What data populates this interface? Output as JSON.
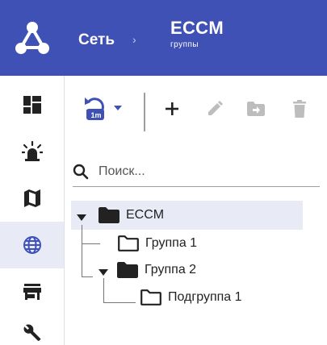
{
  "header": {
    "logo_icon": "network-logo-icon",
    "breadcrumb_root": "Сеть",
    "breadcrumb_separator": "›",
    "current_title": "ECCM",
    "current_subtitle": "группы",
    "background": "#3f51b5"
  },
  "sidebar": {
    "items": [
      {
        "name": "dashboard",
        "icon": "dashboard-icon",
        "active": false
      },
      {
        "name": "alarms",
        "icon": "alarm-light-icon",
        "active": false
      },
      {
        "name": "map",
        "icon": "map-icon",
        "active": false
      },
      {
        "name": "network",
        "icon": "globe-icon",
        "active": true
      },
      {
        "name": "store",
        "icon": "store-icon",
        "active": false
      },
      {
        "name": "settings",
        "icon": "wrench-icon",
        "active": false
      }
    ]
  },
  "toolbar": {
    "refresh_badge": "1m",
    "refresh_icon": "refresh-interval-icon",
    "add_icon": "plus-icon",
    "edit_icon": "pencil-icon",
    "move_icon": "folder-move-icon",
    "delete_icon": "trash-icon",
    "accent": "#3f51b5"
  },
  "search": {
    "placeholder": "Поиск...",
    "value": ""
  },
  "tree": {
    "nodes": [
      {
        "label": "ECCM",
        "expanded": true,
        "selected": true,
        "level": 0,
        "icon": "folder-filled-icon"
      },
      {
        "label": "Группа 1",
        "expanded": false,
        "selected": false,
        "level": 1,
        "icon": "folder-outline-icon"
      },
      {
        "label": "Группа 2",
        "expanded": true,
        "selected": false,
        "level": 1,
        "icon": "folder-filled-icon"
      },
      {
        "label": "Подгруппа 1",
        "expanded": false,
        "selected": false,
        "level": 2,
        "icon": "folder-outline-icon"
      }
    ]
  }
}
